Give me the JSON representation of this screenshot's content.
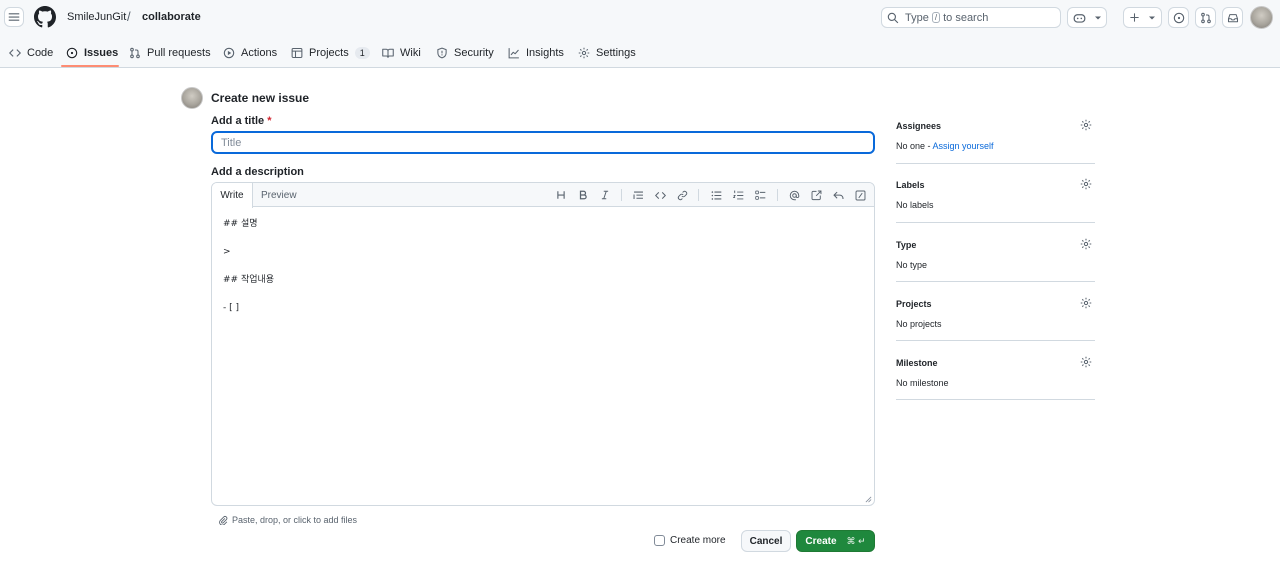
{
  "header": {
    "owner": "SmileJunGit",
    "separator": "/",
    "repo": "collaborate",
    "search": {
      "prefix": "Type",
      "key": "/",
      "suffix": "to search"
    }
  },
  "tabs": [
    {
      "label": "Code",
      "icon": "code-icon"
    },
    {
      "label": "Issues",
      "icon": "issue-opened-icon",
      "active": true
    },
    {
      "label": "Pull requests",
      "icon": "git-pull-request-icon"
    },
    {
      "label": "Actions",
      "icon": "play-icon"
    },
    {
      "label": "Projects",
      "icon": "table-icon",
      "count": "1"
    },
    {
      "label": "Wiki",
      "icon": "book-icon"
    },
    {
      "label": "Security",
      "icon": "shield-icon"
    },
    {
      "label": "Insights",
      "icon": "graph-icon"
    },
    {
      "label": "Settings",
      "icon": "gear-icon"
    }
  ],
  "main": {
    "page_title": "Create new issue",
    "title_label": "Add a title",
    "required_mark": "*",
    "title_placeholder": "Title",
    "description_label": "Add a description",
    "editor_tabs": {
      "write": "Write",
      "preview": "Preview"
    },
    "toolbar_icons": [
      "heading-icon",
      "bold-icon",
      "italic-icon",
      "quote-icon",
      "code-icon",
      "link-icon",
      "unordered-list-icon",
      "ordered-list-icon",
      "task-list-icon",
      "mention-icon",
      "cross-reference-icon",
      "reply-icon",
      "slash-command-icon"
    ],
    "body_lines": [
      "## 설명",
      ">",
      "## 작업내용",
      "- [ ]"
    ],
    "attach_text": "Paste, drop, or click to add files",
    "create_more_label": "Create more",
    "cancel_label": "Cancel",
    "create_label": "Create",
    "create_shortcut": "⌘ ↵"
  },
  "sidebar": [
    {
      "heading": "Assignees",
      "value": "No one - ",
      "link": "Assign yourself"
    },
    {
      "heading": "Labels",
      "value": "No labels"
    },
    {
      "heading": "Type",
      "value": "No type"
    },
    {
      "heading": "Projects",
      "value": "No projects"
    },
    {
      "heading": "Milestone",
      "value": "No milestone"
    }
  ],
  "colors": {
    "accent": "#0969da",
    "active_tab_underline": "#fd8c73",
    "create_button": "#1f883d",
    "required": "#d1242f"
  }
}
